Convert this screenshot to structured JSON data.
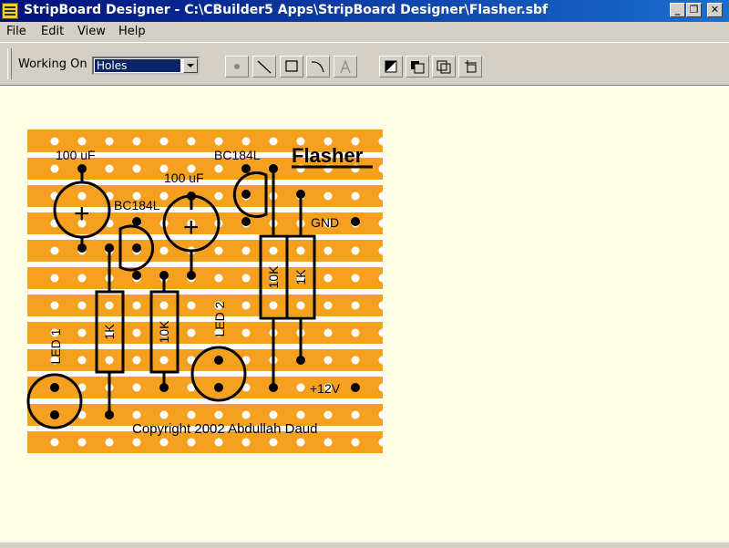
{
  "window": {
    "title": "StripBoard Designer - C:\\CBuilder5 Apps\\StripBoard Designer\\Flasher.sbf",
    "buttons": {
      "minimize": "_",
      "restore": "❐",
      "close": "✕"
    }
  },
  "menu": {
    "items": [
      "File",
      "Edit",
      "View",
      "Help"
    ]
  },
  "toolbar": {
    "working_on_label": "Working On",
    "working_on_value": "Holes",
    "draw_tools": [
      "dot-icon",
      "line-icon",
      "rectangle-icon",
      "arc-icon",
      "text-icon"
    ],
    "layer_tools": [
      "bring-front-icon",
      "send-back-icon",
      "group-icon",
      "align-icon"
    ]
  },
  "board": {
    "strip_color": "#f5a01e",
    "labels": {
      "title": "Flasher",
      "cap1": "100 uF",
      "cap2": "100 uF",
      "transistor1": "BC184L",
      "transistor2": "BC184L",
      "gnd": "GND",
      "vcc": "+12V",
      "r1": "1K",
      "r2": "10K",
      "r3": "10K",
      "r4": "1K",
      "led1": "LED 1",
      "led2": "LED 2",
      "plus1": "+",
      "plus2": "+",
      "copyright": "Copyright 2002 Abdullah Daud"
    }
  }
}
